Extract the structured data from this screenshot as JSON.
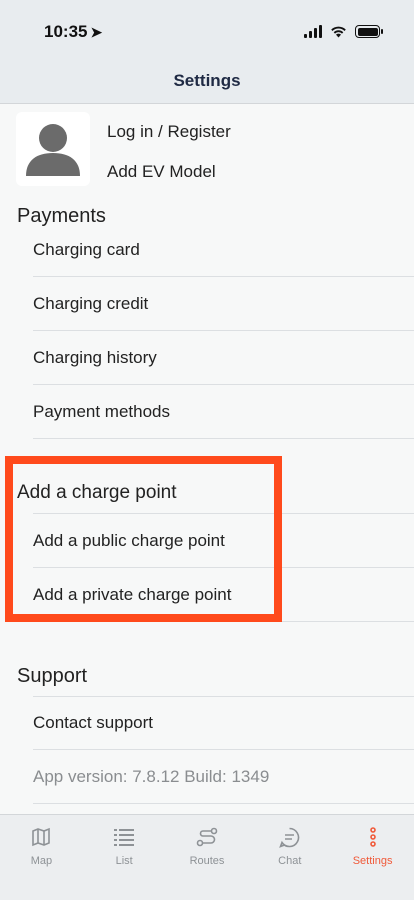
{
  "status": {
    "time": "10:35"
  },
  "nav": {
    "title": "Settings"
  },
  "profile": {
    "login_label": "Log in / Register",
    "ev_label": "Add EV Model"
  },
  "payments": {
    "title": "Payments",
    "items": [
      "Charging card",
      "Charging credit",
      "Charging history",
      "Payment methods"
    ]
  },
  "charge_point": {
    "title": "Add a charge point",
    "items": [
      "Add a public charge point",
      "Add a private charge point"
    ]
  },
  "support": {
    "title": "Support",
    "contact": "Contact support",
    "version": "App version: 7.8.12 Build: 1349"
  },
  "tabs": [
    {
      "label": "Map",
      "icon": "map-icon"
    },
    {
      "label": "List",
      "icon": "list-icon"
    },
    {
      "label": "Routes",
      "icon": "routes-icon"
    },
    {
      "label": "Chat",
      "icon": "chat-icon"
    },
    {
      "label": "Settings",
      "icon": "more-vertical-icon",
      "active": true
    }
  ],
  "colors": {
    "accent": "#f05a3a",
    "highlight": "#ff4a1c",
    "nav_title": "#1f2a44"
  }
}
